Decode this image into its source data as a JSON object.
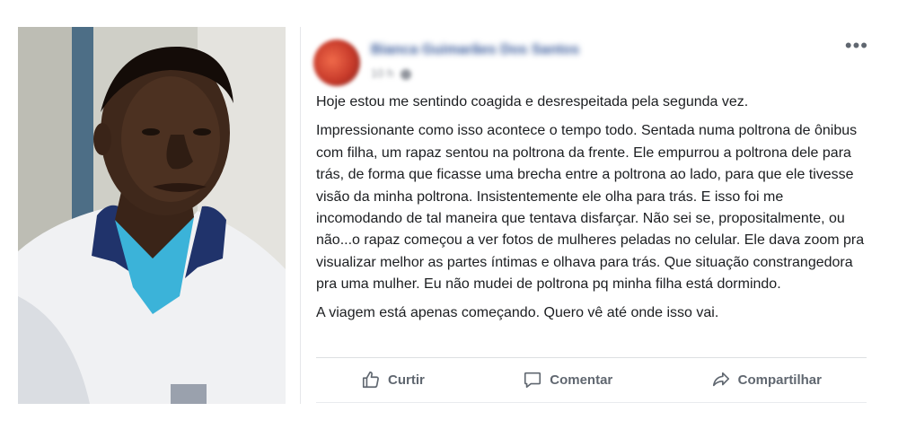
{
  "post": {
    "author_name": "Bianca Guimarães Dos Santos",
    "timestamp": "10 h",
    "more_icon": "more-horizontal-icon",
    "paragraphs": [
      "Hoje estou me sentindo coagida e desrespeitada pela segunda vez.",
      "Impressionante como isso acontece o tempo todo. Sentada numa poltrona de ônibus com filha, um rapaz sentou na poltrona da frente. Ele empurrou a poltrona dele para trás, de forma que ficasse uma brecha entre a poltrona ao lado, para que ele tivesse visão da minha poltrona. Insistentemente ele olha para trás. E isso foi me incomodando de tal maneira que tentava disfarçar. Não sei se, propositalmente, ou não...o rapaz começou a ver fotos de mulheres peladas no celular. Ele dava zoom pra visualizar melhor as partes íntimas e olhava para trás. Que situação constrangedora pra uma mulher. Eu não mudei de poltrona pq minha filha está dormindo.",
      "A viagem está apenas começando. Quero vê até onde isso vai."
    ],
    "actions": {
      "like": {
        "label": "Curtir",
        "icon": "thumbs-up-icon"
      },
      "comment": {
        "label": "Comentar",
        "icon": "comment-bubble-icon"
      },
      "share": {
        "label": "Compartilhar",
        "icon": "share-arrow-icon"
      }
    }
  },
  "colors": {
    "author_link": "#365899",
    "text": "#1c1e21",
    "muted": "#606770",
    "divider": "#dddfe2"
  }
}
